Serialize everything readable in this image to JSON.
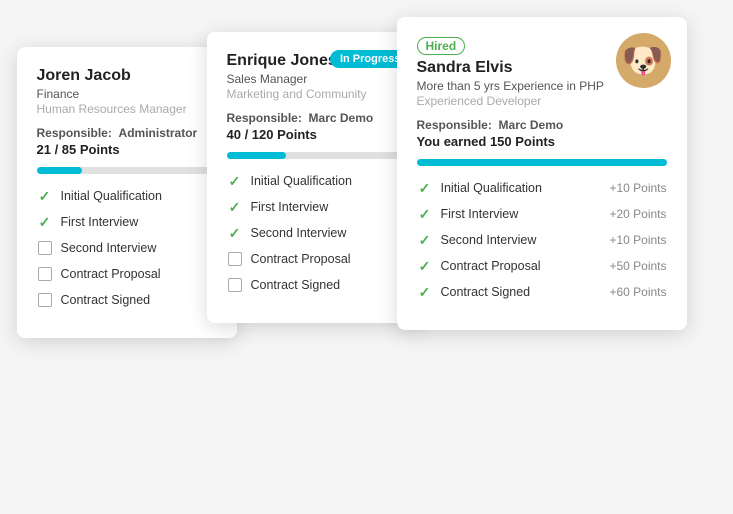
{
  "card1": {
    "name": "Joren Jacob",
    "title": "Finance",
    "dept": "Human Resources Manager",
    "responsible_label": "Responsible:",
    "responsible_name": "Administrator",
    "points": "21 / 85 Points",
    "progress_pct": 25,
    "checklist": [
      {
        "label": "Initial Qualification",
        "done": true
      },
      {
        "label": "First Interview",
        "done": true
      },
      {
        "label": "Second Interview",
        "done": false
      },
      {
        "label": "Contract Proposal",
        "done": false
      },
      {
        "label": "Contract Signed",
        "done": false
      }
    ]
  },
  "card2": {
    "name": "Enrique Jones",
    "title": "Sales Manager",
    "dept": "Marketing and Community",
    "badge": "In Progress",
    "responsible_label": "Responsible:",
    "responsible_name": "Marc Demo",
    "points": "40 / 120 Points",
    "progress_pct": 33,
    "checklist": [
      {
        "label": "Initial Qualification",
        "done": true
      },
      {
        "label": "First Interview",
        "done": true
      },
      {
        "label": "Second Interview",
        "done": true
      },
      {
        "label": "Contract Proposal",
        "done": false
      },
      {
        "label": "Contract Signed",
        "done": false
      }
    ]
  },
  "card3": {
    "name": "Sandra Elvis",
    "subtitle": "More than 5 yrs Experience in PHP",
    "subdept": "Experienced Developer",
    "badge": "Hired",
    "responsible_label": "Responsible:",
    "responsible_name": "Marc Demo",
    "earned_label": "You earned 150 Points",
    "progress_pct": 100,
    "checklist": [
      {
        "label": "Initial Qualification",
        "done": true,
        "points": "+10 Points"
      },
      {
        "label": "First Interview",
        "done": true,
        "points": "+20 Points"
      },
      {
        "label": "Second Interview",
        "done": true,
        "points": "+10 Points"
      },
      {
        "label": "Contract Proposal",
        "done": true,
        "points": "+50 Points"
      },
      {
        "label": "Contract Signed",
        "done": true,
        "points": "+60 Points"
      }
    ]
  }
}
